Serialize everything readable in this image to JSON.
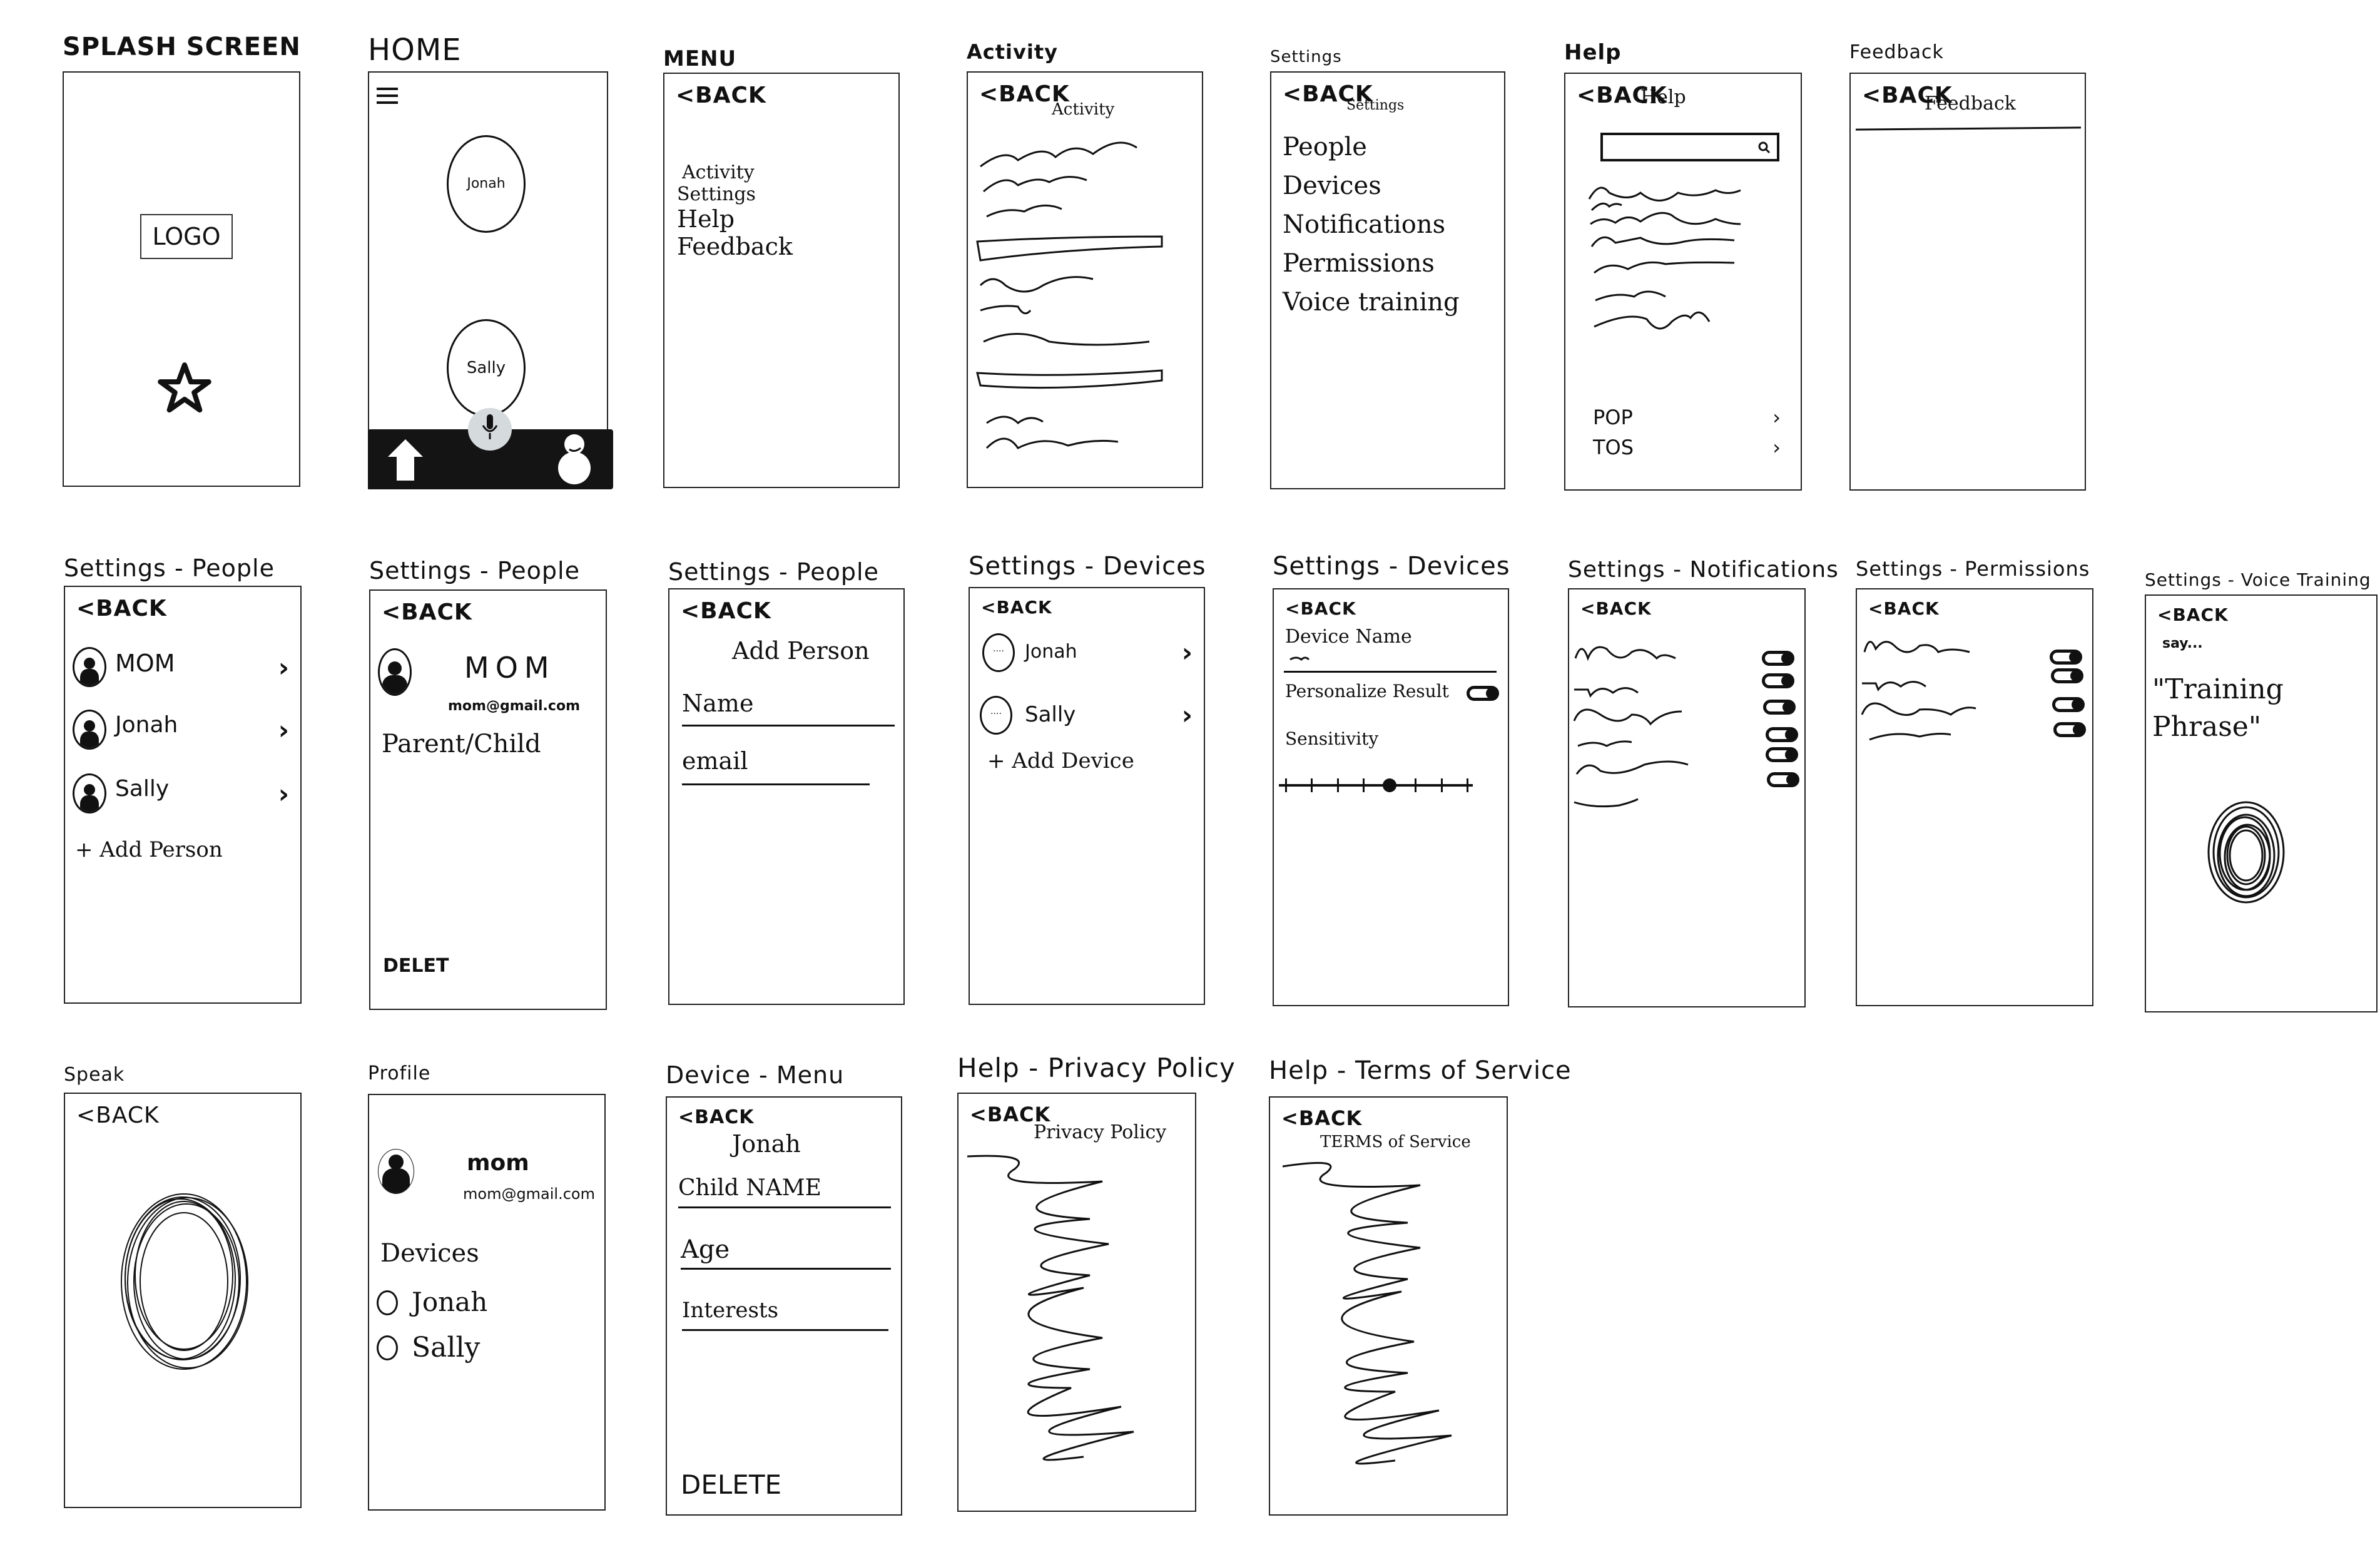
{
  "common": {
    "back_label": "<BACK"
  },
  "screens": {
    "splash": {
      "caption": "SPLASH SCREEN",
      "logo_label": "LOGO",
      "icon": "star-icon"
    },
    "home": {
      "caption": "HOME",
      "menu_icon": "hamburger-menu-icon",
      "profiles": [
        "Jonah",
        "Sally"
      ],
      "bottom_bar": {
        "left_icon": "home-arrow-icon",
        "center_icon": "microphone-icon",
        "right_icon": "user-profile-icon",
        "accent_center": "#d5dadd"
      }
    },
    "menu": {
      "caption": "MENU",
      "items": [
        "Activity",
        "Settings",
        "Help",
        "Feedback"
      ]
    },
    "activity": {
      "caption": "Activity",
      "title": "Activity"
    },
    "settings": {
      "caption": "Settings",
      "title": "Settings",
      "items": [
        "People",
        "Devices",
        "Notifications",
        "Permissions",
        "Voice training"
      ]
    },
    "help": {
      "caption": "Help",
      "title": "Help",
      "search_icon": "search-icon",
      "links": [
        "POP",
        "TOS"
      ]
    },
    "feedback": {
      "caption": "Feedback",
      "title": "Feedback"
    },
    "people_list": {
      "caption": "Settings - People",
      "people": [
        "MOM",
        "Jonah",
        "Sally"
      ],
      "add_label": "+ Add Person"
    },
    "people_detail": {
      "caption": "Settings - People",
      "name": "MOM",
      "email": "mom@gmail.com",
      "role": "Parent/Child",
      "delete_label": "DELET"
    },
    "people_add": {
      "caption": "Settings - People",
      "title": "Add Person",
      "fields": [
        "Name",
        "email"
      ]
    },
    "devices_list": {
      "caption": "Settings - Devices",
      "devices": [
        "Jonah",
        "Sally"
      ],
      "add_label": "+ Add Device"
    },
    "device_settings": {
      "caption": "Settings - Devices",
      "name_label": "Device Name",
      "personalize_label": "Personalize Result",
      "personalize_on": true,
      "sensitivity_label": "Sensitivity",
      "sensitivity_ticks": 8,
      "sensitivity_value": 0.57
    },
    "notifications": {
      "caption": "Settings - Notifications",
      "toggle_count": 6
    },
    "permissions": {
      "caption": "Settings - Permissions",
      "toggle_count": 4
    },
    "voice_training": {
      "caption": "Settings - Voice Training",
      "prompt": "say...",
      "phrase": "\"Training Phrase\""
    },
    "speak": {
      "caption": "Speak"
    },
    "profile": {
      "caption": "Profile",
      "name": "mom",
      "email": "mom@gmail.com",
      "devices_label": "Devices",
      "devices": [
        "Jonah",
        "Sally"
      ]
    },
    "device_menu": {
      "caption": "Device - Menu",
      "title": "Jonah",
      "fields": [
        "Child NAME",
        "Age",
        "Interests"
      ],
      "delete_label": "DELETE"
    },
    "privacy": {
      "caption": "Help - Privacy Policy",
      "title": "Privacy Policy"
    },
    "terms": {
      "caption": "Help - Terms of Service",
      "title": "TERMS of Service"
    }
  }
}
